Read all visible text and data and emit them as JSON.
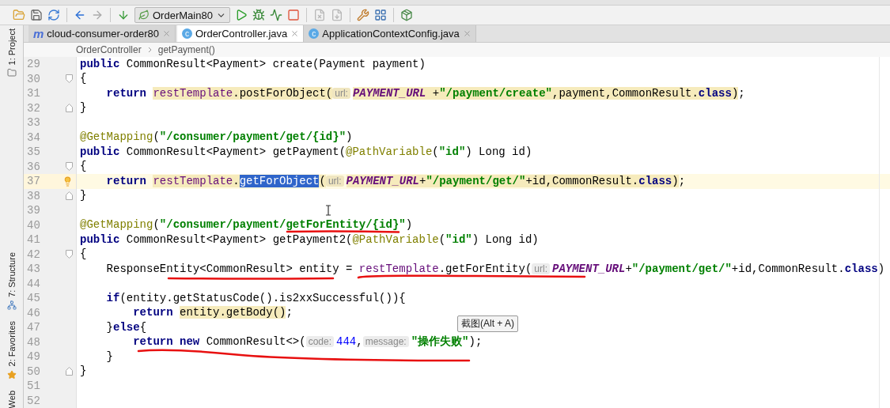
{
  "toolbar": {
    "run_config": "OrderMain80"
  },
  "tool_strip": {
    "top": [
      {
        "label": "1: Project"
      }
    ],
    "bottom": [
      {
        "label": "7: Structure"
      },
      {
        "label": "2: Favorites"
      },
      {
        "label": "Web"
      }
    ]
  },
  "tabs": [
    {
      "label": "cloud-consumer-order80",
      "kind": "module",
      "icon": "m",
      "selected": false
    },
    {
      "label": "OrderController.java",
      "kind": "class",
      "icon": "c",
      "selected": true
    },
    {
      "label": "ApplicationContextConfig.java",
      "kind": "class",
      "icon": "c",
      "selected": false
    }
  ],
  "breadcrumb": [
    "OrderController",
    "getPayment()"
  ],
  "editor": {
    "lines": [
      {
        "number": "29",
        "tokens": [
          {
            "kind": "kw",
            "text": "public "
          },
          {
            "kind": "plain",
            "text": "CommonResult<Payment> create(Payment payment)"
          }
        ]
      },
      {
        "number": "30",
        "fold_open": true,
        "tokens": [
          {
            "kind": "plain",
            "text": "{"
          }
        ]
      },
      {
        "number": "31",
        "tokens": [
          {
            "kind": "kw",
            "text": "    return "
          },
          {
            "kind": "field",
            "text": "restTemplate",
            "marked": true
          },
          {
            "kind": "plain",
            "text": ".postForObject(",
            "marked": true
          },
          {
            "kind": "hint",
            "text": "url:",
            "marked": true
          },
          {
            "kind": "const",
            "text": "PAYMENT_URL",
            "marked": true
          },
          {
            "kind": "plain",
            "text": " +",
            "marked": true
          },
          {
            "kind": "str",
            "text": "\"/payment/create\"",
            "marked": true
          },
          {
            "kind": "plain",
            "text": ",payment,CommonResult.",
            "marked": true
          },
          {
            "kind": "kw",
            "text": "class",
            "marked": true
          },
          {
            "kind": "plain",
            "text": ")",
            "marked": true
          },
          {
            "kind": "plain",
            "text": ";"
          }
        ]
      },
      {
        "number": "32",
        "fold_close": true,
        "tokens": [
          {
            "kind": "plain",
            "text": "}"
          }
        ]
      },
      {
        "number": "33"
      },
      {
        "number": "34",
        "tokens": [
          {
            "kind": "ann",
            "text": "@GetMapping"
          },
          {
            "kind": "plain",
            "text": "("
          },
          {
            "kind": "str",
            "text": "\"/consumer/payment/get/{id}\""
          },
          {
            "kind": "plain",
            "text": ")"
          }
        ]
      },
      {
        "number": "35",
        "tokens": [
          {
            "kind": "kw",
            "text": "public "
          },
          {
            "kind": "plain",
            "text": "CommonResult<Payment> getPayment("
          },
          {
            "kind": "ann",
            "text": "@PathVariable"
          },
          {
            "kind": "plain",
            "text": "("
          },
          {
            "kind": "str",
            "text": "\"id\""
          },
          {
            "kind": "plain",
            "text": ") Long id)"
          }
        ]
      },
      {
        "number": "36",
        "fold_open": true,
        "tokens": [
          {
            "kind": "plain",
            "text": "{"
          }
        ]
      },
      {
        "number": "37",
        "current": true,
        "bulb": true,
        "tokens": [
          {
            "kind": "kw",
            "text": "    return "
          },
          {
            "kind": "field",
            "text": "restTemplate",
            "marked": true
          },
          {
            "kind": "plain",
            "text": ".",
            "marked": true
          },
          {
            "kind": "sel",
            "text": "getForObject"
          },
          {
            "kind": "plain",
            "text": "(",
            "marked": true
          },
          {
            "kind": "hint",
            "text": "url:",
            "marked": true
          },
          {
            "kind": "const",
            "text": "PAYMENT_URL",
            "marked": true
          },
          {
            "kind": "plain",
            "text": "+",
            "marked": true
          },
          {
            "kind": "str",
            "text": "\"/payment/get/\"",
            "marked": true
          },
          {
            "kind": "plain",
            "text": "+id,CommonResult.",
            "marked": true
          },
          {
            "kind": "kw",
            "text": "class",
            "marked": true
          },
          {
            "kind": "plain",
            "text": ")",
            "marked": true
          },
          {
            "kind": "plain",
            "text": ";"
          }
        ]
      },
      {
        "number": "38",
        "fold_close": true,
        "tokens": [
          {
            "kind": "plain",
            "text": "}"
          }
        ]
      },
      {
        "number": "39"
      },
      {
        "number": "40",
        "tokens": [
          {
            "kind": "ann",
            "text": "@GetMapping"
          },
          {
            "kind": "plain",
            "text": "("
          },
          {
            "kind": "str",
            "text": "\"/consumer/payment/getForEntity/{id}\""
          },
          {
            "kind": "plain",
            "text": ")"
          }
        ]
      },
      {
        "number": "41",
        "tokens": [
          {
            "kind": "kw",
            "text": "public "
          },
          {
            "kind": "plain",
            "text": "CommonResult<Payment> getPayment2("
          },
          {
            "kind": "ann",
            "text": "@PathVariable"
          },
          {
            "kind": "plain",
            "text": "("
          },
          {
            "kind": "str",
            "text": "\"id\""
          },
          {
            "kind": "plain",
            "text": ") Long id)"
          }
        ]
      },
      {
        "number": "42",
        "fold_open": true,
        "tokens": [
          {
            "kind": "plain",
            "text": "{"
          }
        ]
      },
      {
        "number": "43",
        "tokens": [
          {
            "kind": "plain",
            "text": "    ResponseEntity<CommonResult> entity = "
          },
          {
            "kind": "field",
            "text": "restTemplate"
          },
          {
            "kind": "plain",
            "text": ".getForEntity("
          },
          {
            "kind": "hint",
            "text": "url:"
          },
          {
            "kind": "const",
            "text": "PAYMENT_URL"
          },
          {
            "kind": "plain",
            "text": "+"
          },
          {
            "kind": "str",
            "text": "\"/payment/get/\""
          },
          {
            "kind": "plain",
            "text": "+id,CommonResult."
          },
          {
            "kind": "kw",
            "text": "class"
          },
          {
            "kind": "plain",
            "text": ")"
          }
        ]
      },
      {
        "number": "44"
      },
      {
        "number": "45",
        "tokens": [
          {
            "kind": "kw",
            "text": "    if"
          },
          {
            "kind": "plain",
            "text": "(entity.getStatusCode().is2xxSuccessful()){"
          }
        ]
      },
      {
        "number": "46",
        "tokens": [
          {
            "kind": "kw",
            "text": "        return "
          },
          {
            "kind": "plain",
            "text": "entity.getBody()",
            "marked": true
          },
          {
            "kind": "plain",
            "text": ";"
          }
        ]
      },
      {
        "number": "47",
        "tokens": [
          {
            "kind": "plain",
            "text": "    }"
          },
          {
            "kind": "kw",
            "text": "else"
          },
          {
            "kind": "plain",
            "text": "{"
          }
        ]
      },
      {
        "number": "48",
        "tokens": [
          {
            "kind": "kw",
            "text": "        return new "
          },
          {
            "kind": "plain",
            "text": "CommonResult<>("
          },
          {
            "kind": "hint",
            "text": "code:"
          },
          {
            "kind": "num",
            "text": "444"
          },
          {
            "kind": "plain",
            "text": ","
          },
          {
            "kind": "hint",
            "text": "message:"
          },
          {
            "kind": "str",
            "text": "\"操作失败\""
          },
          {
            "kind": "plain",
            "text": ");"
          }
        ]
      },
      {
        "number": "49",
        "tokens": [
          {
            "kind": "plain",
            "text": "    }"
          }
        ]
      },
      {
        "number": "50",
        "fold_close": true,
        "tokens": [
          {
            "kind": "plain",
            "text": "}"
          }
        ]
      },
      {
        "number": "51"
      },
      {
        "number": "52"
      }
    ]
  },
  "tooltip": "截图(Alt + A)"
}
